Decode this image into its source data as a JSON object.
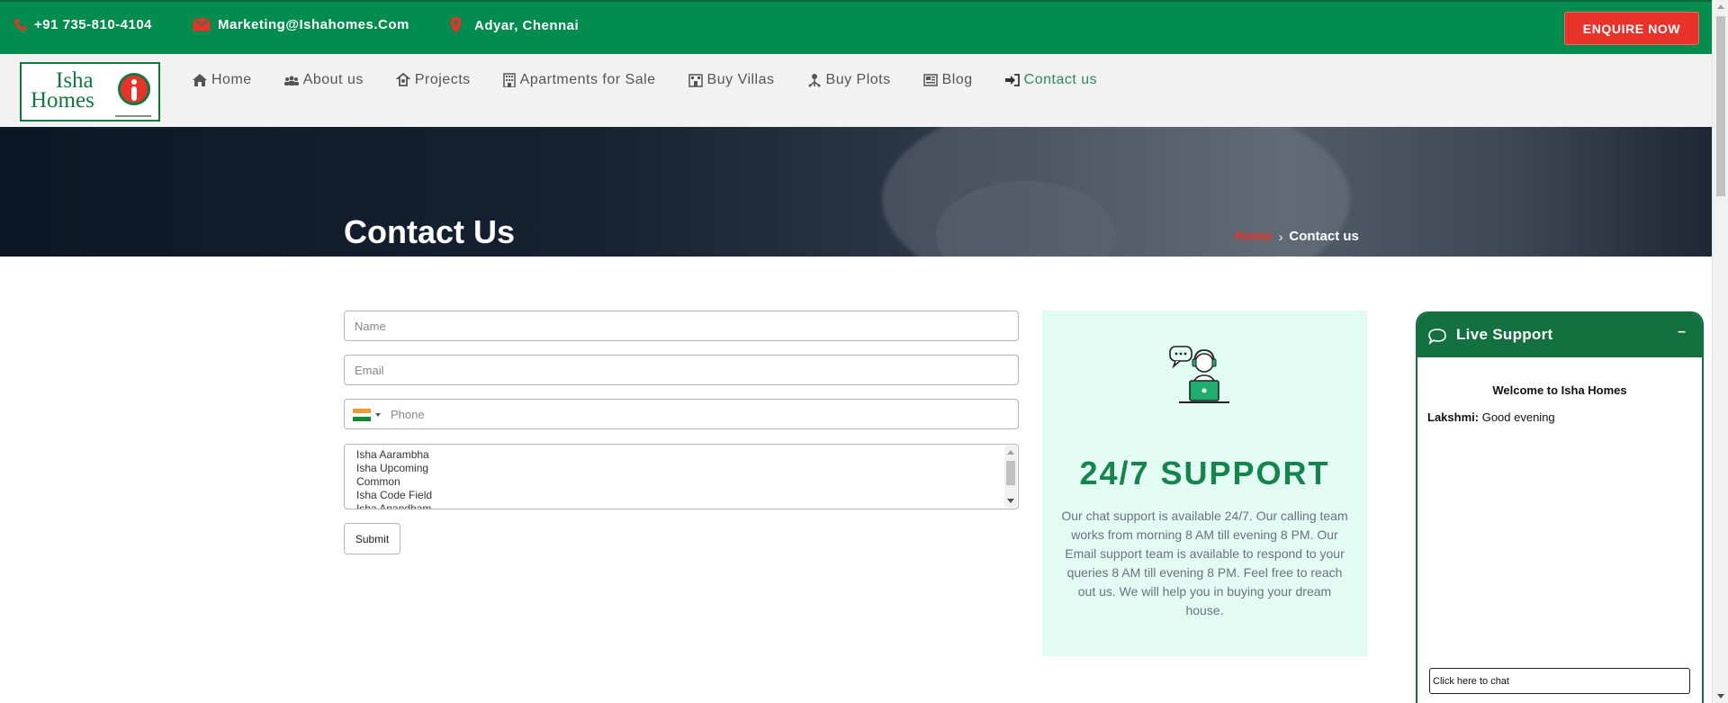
{
  "topbar": {
    "phone": "+91 735-810-4104",
    "email": "Marketing@Ishahomes.Com",
    "location": "Adyar, Chennai",
    "enquire_label": "ENQUIRE NOW",
    "background_color": "#028d4e",
    "accent_color": "#e8322a"
  },
  "logo": {
    "line1": "Isha",
    "line2": "Homes"
  },
  "nav": {
    "items": [
      {
        "label": "Home",
        "icon": "home-icon"
      },
      {
        "label": "About us",
        "icon": "users-icon"
      },
      {
        "label": "Projects",
        "icon": "projects-icon"
      },
      {
        "label": "Apartments for Sale",
        "icon": "building-icon"
      },
      {
        "label": "Buy Villas",
        "icon": "villa-icon"
      },
      {
        "label": "Buy Plots",
        "icon": "plot-icon"
      },
      {
        "label": "Blog",
        "icon": "newspaper-icon"
      },
      {
        "label": "Contact us",
        "icon": "sign-in-icon",
        "active": true
      }
    ]
  },
  "hero": {
    "title": "Contact Us",
    "breadcrumb": {
      "home": "Home",
      "separator": "›",
      "current": "Contact us"
    }
  },
  "form": {
    "name_placeholder": "Name",
    "email_placeholder": "Email",
    "phone_placeholder": "Phone",
    "project_options": [
      "Isha Aarambha",
      "Isha Upcoming",
      "Common",
      "Isha Code Field",
      "Isha Anandham"
    ],
    "submit_label": "Submit"
  },
  "support": {
    "title": "24/7 SUPPORT",
    "description": "Our chat support is available 24/7. Our calling team works from morning 8 AM till evening 8 PM. Our Email support team is available to respond to your queries 8 AM till evening 8 PM. Feel free to reach out us. We will help you in buying your dream house."
  },
  "chat": {
    "title": "Live Support",
    "minimize_label": "–",
    "welcome": "Welcome to Isha Homes",
    "messages": [
      {
        "sender": "Lakshmi:",
        "text": "Good evening"
      }
    ],
    "input_placeholder": "Click here to chat"
  }
}
